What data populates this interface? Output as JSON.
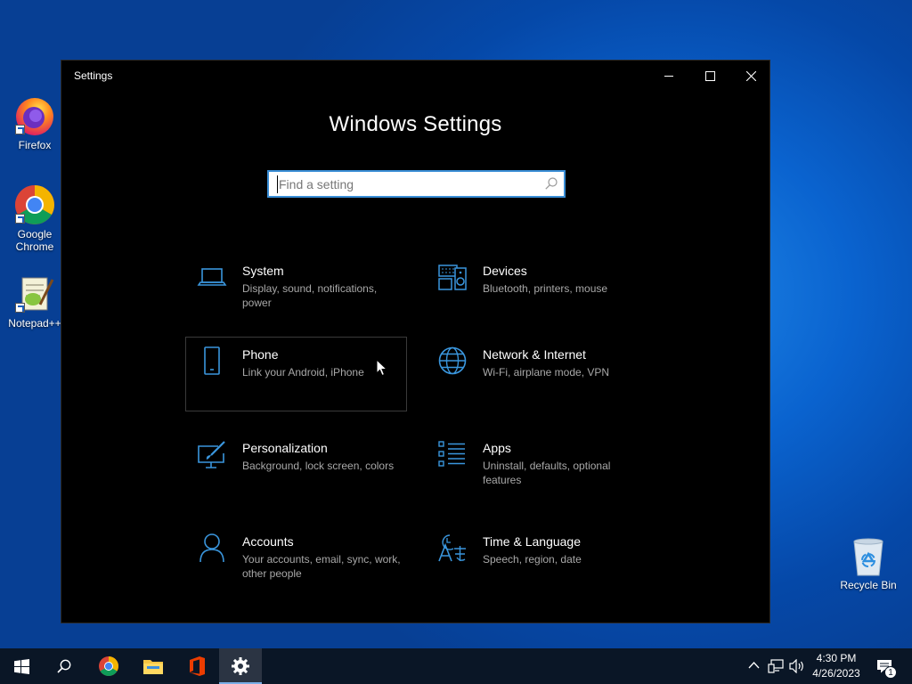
{
  "desktop": {
    "icons": [
      {
        "label": "Firefox"
      },
      {
        "label": "Google Chrome"
      },
      {
        "label": "Notepad++"
      },
      {
        "label": "Recycle Bin"
      }
    ]
  },
  "window": {
    "title": "Settings",
    "heading": "Windows Settings",
    "search_placeholder": "Find a setting",
    "accent_color": "#3a96dd",
    "tiles": [
      {
        "name": "System",
        "desc": "Display, sound, notifications, power",
        "icon": "laptop-icon"
      },
      {
        "name": "Devices",
        "desc": "Bluetooth, printers, mouse",
        "icon": "devices-icon"
      },
      {
        "name": "Phone",
        "desc": "Link your Android, iPhone",
        "icon": "phone-icon"
      },
      {
        "name": "Network & Internet",
        "desc": "Wi-Fi, airplane mode, VPN",
        "icon": "globe-icon"
      },
      {
        "name": "Personalization",
        "desc": "Background, lock screen, colors",
        "icon": "paint-icon"
      },
      {
        "name": "Apps",
        "desc": "Uninstall, defaults, optional features",
        "icon": "apps-list-icon"
      },
      {
        "name": "Accounts",
        "desc": "Your accounts, email, sync, work, other people",
        "icon": "person-icon"
      },
      {
        "name": "Time & Language",
        "desc": "Speech, region, date",
        "icon": "time-language-icon"
      }
    ]
  },
  "taskbar": {
    "time": "4:30 PM",
    "date": "4/26/2023",
    "notification_count": "1"
  }
}
